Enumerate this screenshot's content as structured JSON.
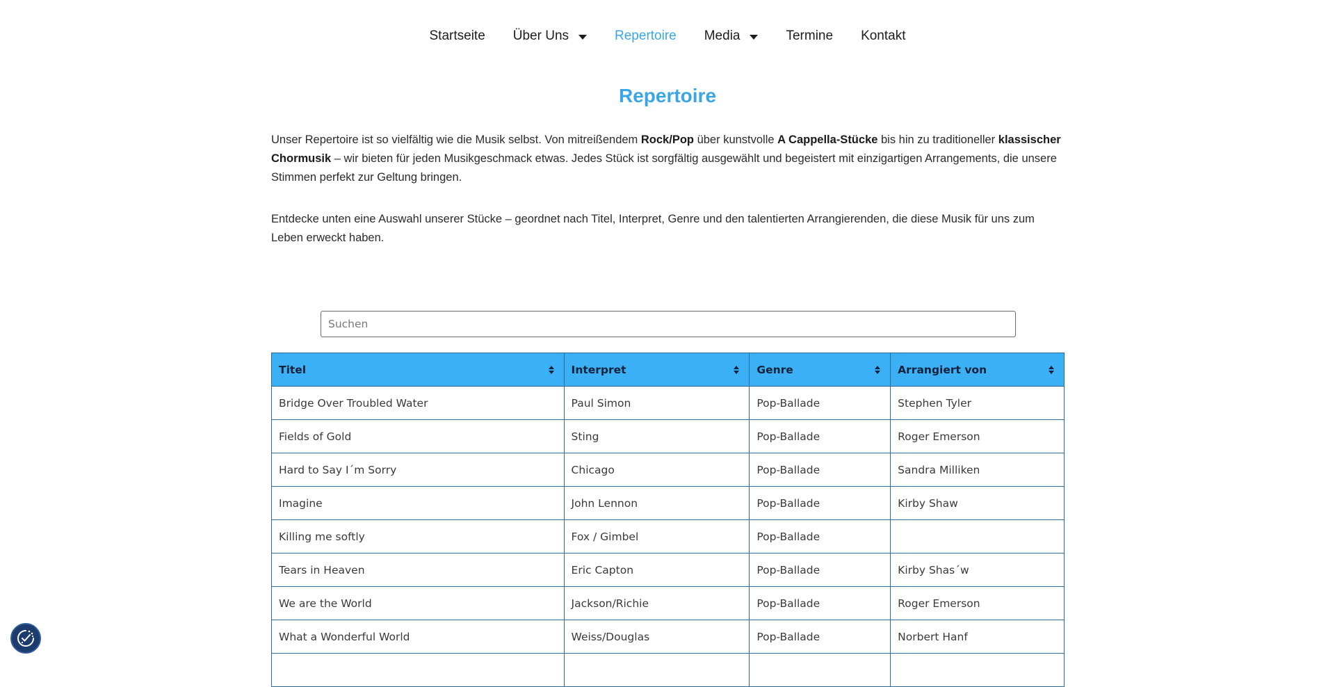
{
  "nav": {
    "items": [
      {
        "label": "Startseite",
        "has_caret": false,
        "active": false
      },
      {
        "label": "Über Uns",
        "has_caret": true,
        "active": false
      },
      {
        "label": "Repertoire",
        "has_caret": false,
        "active": true
      },
      {
        "label": "Media",
        "has_caret": true,
        "active": false
      },
      {
        "label": "Termine",
        "has_caret": false,
        "active": false
      },
      {
        "label": "Kontakt",
        "has_caret": false,
        "active": false
      }
    ]
  },
  "page": {
    "title": "Repertoire",
    "accent_color": "#3ba6e6",
    "header_color": "#3bb0f5"
  },
  "intro": {
    "p1": [
      {
        "text": "Unser Repertoire ist so vielfältig wie die Musik selbst. Von mitreißendem ",
        "bold": false
      },
      {
        "text": "Rock/Pop",
        "bold": true
      },
      {
        "text": " über kunstvolle ",
        "bold": false
      },
      {
        "text": "A Cappella-Stücke",
        "bold": true
      },
      {
        "text": " bis hin zu traditioneller ",
        "bold": false
      },
      {
        "text": "klassischer Chormusik",
        "bold": true
      },
      {
        "text": " – wir bieten für jeden Musikgeschmack etwas. Jedes Stück ist sorgfältig ausgewählt und begeistert mit einzigartigen Arrangements, die unsere Stimmen perfekt zur Geltung bringen.",
        "bold": false
      }
    ],
    "p2": "Entdecke unten eine Auswahl unserer Stücke – geordnet nach Titel, Interpret, Genre und den talentierten Arrangierenden, die diese Musik für uns zum Leben erweckt haben."
  },
  "search": {
    "placeholder": "Suchen",
    "value": ""
  },
  "table": {
    "columns": [
      "Titel",
      "Interpret",
      "Genre",
      "Arrangiert von"
    ],
    "rows": [
      [
        "Bridge Over Troubled Water",
        "Paul Simon",
        "Pop-Ballade",
        "Stephen Tyler"
      ],
      [
        "Fields of Gold",
        "Sting",
        "Pop-Ballade",
        "Roger Emerson"
      ],
      [
        "Hard to Say I´m Sorry",
        "Chicago",
        "Pop-Ballade",
        "Sandra Milliken"
      ],
      [
        "Imagine",
        "John Lennon",
        "Pop-Ballade",
        "Kirby Shaw"
      ],
      [
        "Killing me softly",
        "Fox / Gimbel",
        "Pop-Ballade",
        ""
      ],
      [
        "Tears in Heaven",
        "Eric Capton",
        "Pop-Ballade",
        "Kirby Shas´w"
      ],
      [
        "We are the World",
        "Jackson/Richie",
        "Pop-Ballade",
        "Roger Emerson"
      ],
      [
        "What a Wonderful World",
        "Weiss/Douglas",
        "Pop-Ballade",
        "Norbert Hanf"
      ],
      [
        "",
        "",
        "",
        ""
      ]
    ]
  },
  "cookie_widget": {
    "icon": "cookie-consent-icon"
  }
}
